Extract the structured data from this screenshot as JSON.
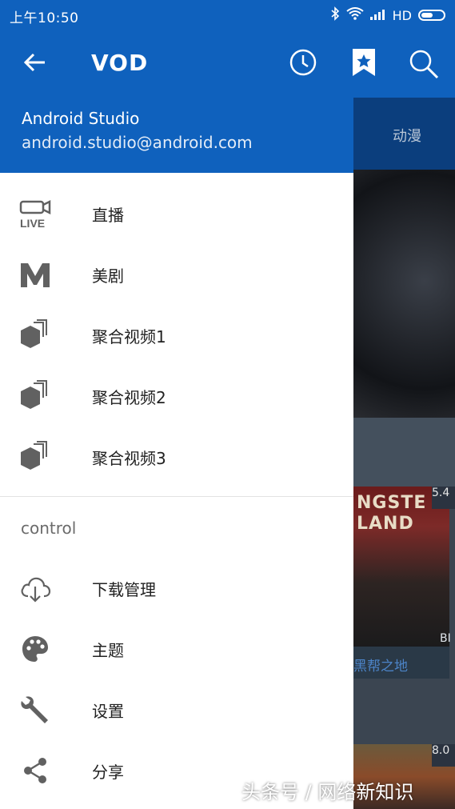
{
  "status_bar": {
    "time": "上午10:50",
    "network": "HD"
  },
  "toolbar": {
    "title": "VOD"
  },
  "drawer": {
    "header": {
      "name": "Android Studio",
      "email": "android.studio@android.com"
    },
    "items": [
      {
        "label": "直播",
        "icon": "live-icon"
      },
      {
        "label": "美剧",
        "icon": "m-logo-icon"
      },
      {
        "label": "聚合视频1",
        "icon": "stack-icon"
      },
      {
        "label": "聚合视频2",
        "icon": "stack-icon"
      },
      {
        "label": "聚合视频3",
        "icon": "stack-icon"
      }
    ],
    "section_title": "control",
    "control_items": [
      {
        "label": "下载管理",
        "icon": "cloud-download-icon"
      },
      {
        "label": "主题",
        "icon": "palette-icon"
      },
      {
        "label": "设置",
        "icon": "wrench-icon"
      },
      {
        "label": "分享",
        "icon": "share-icon"
      }
    ]
  },
  "background": {
    "tab_label": "动漫",
    "poster_title": "NGSTE\nLAND",
    "poster_rating": "5.4",
    "poster_tag": "BI",
    "card_title": "黑帮之地",
    "poster2_rating": "8.0"
  },
  "watermark": "头条号 / 网络新知识",
  "colors": {
    "primary": "#0f61bd",
    "drawer_bg": "#ffffff",
    "icon_gray": "#616161"
  }
}
